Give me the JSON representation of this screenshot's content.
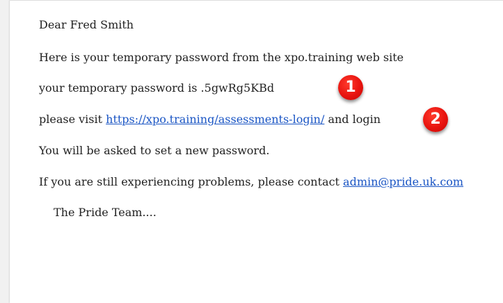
{
  "email": {
    "greeting": "Dear Fred Smith",
    "intro": "Here is your temporary password from the xpo.training web site",
    "password_prefix": "your temporary password is ",
    "password_value": ".5gwRg5KBd",
    "visit_prefix": "please visit ",
    "visit_link": "https://xpo.training/assessments-login/",
    "visit_suffix": " and login",
    "new_password_notice": "You will be asked to set a new password.",
    "problems_prefix": "If you are still experiencing problems, please contact ",
    "contact_email": "admin@pride.uk.com",
    "signoff": "The Pride Team...."
  },
  "annotations": {
    "badge_1": "1",
    "badge_2": "2",
    "badge_color": "#e8140f"
  },
  "colors": {
    "link": "#1a55c4",
    "text": "#222222",
    "background": "#ffffff"
  }
}
